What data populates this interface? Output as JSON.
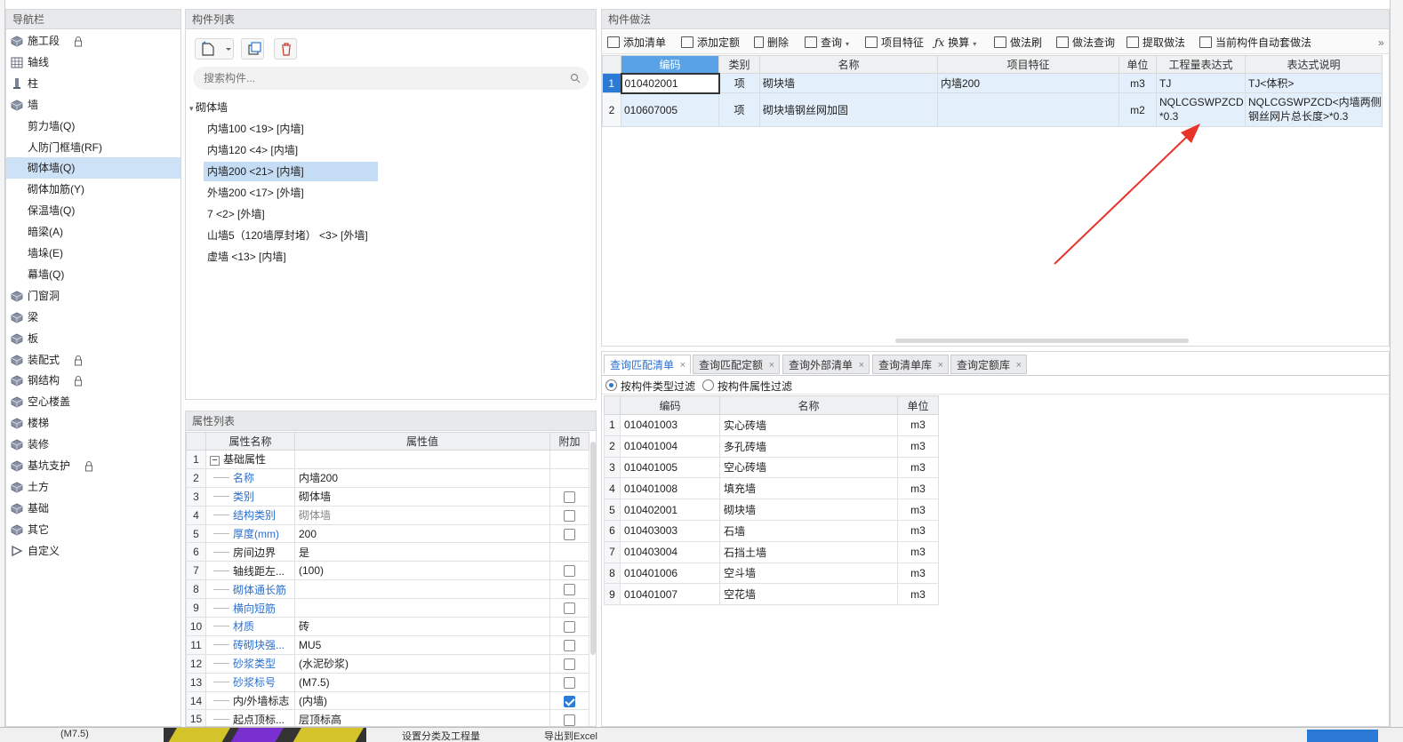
{
  "nav": {
    "title": "导航栏",
    "items": [
      {
        "label": "施工段",
        "icon": "stage-icon",
        "locked": true
      },
      {
        "label": "轴线",
        "icon": "grid-icon"
      },
      {
        "label": "柱",
        "icon": "column-icon"
      },
      {
        "label": "墙",
        "icon": "wall-icon"
      },
      {
        "label": "剪力墙(Q)",
        "sub": true
      },
      {
        "label": "人防门框墙(RF)",
        "sub": true
      },
      {
        "label": "砌体墙(Q)",
        "sub": true,
        "selected": true
      },
      {
        "label": "砌体加筋(Y)",
        "sub": true
      },
      {
        "label": "保温墙(Q)",
        "sub": true
      },
      {
        "label": "暗梁(A)",
        "sub": true
      },
      {
        "label": "墙垛(E)",
        "sub": true
      },
      {
        "label": "幕墙(Q)",
        "sub": true
      },
      {
        "label": "门窗洞",
        "icon": "door-window-icon"
      },
      {
        "label": "梁",
        "icon": "beam-icon"
      },
      {
        "label": "板",
        "icon": "slab-icon"
      },
      {
        "label": "装配式",
        "icon": "prefab-icon",
        "locked": true
      },
      {
        "label": "钢结构",
        "icon": "steel-icon",
        "locked": true
      },
      {
        "label": "空心楼盖",
        "icon": "hollow-floor-icon"
      },
      {
        "label": "楼梯",
        "icon": "stair-icon"
      },
      {
        "label": "装修",
        "icon": "decoration-icon"
      },
      {
        "label": "基坑支护",
        "icon": "pit-support-icon",
        "locked": true
      },
      {
        "label": "土方",
        "icon": "earthwork-icon"
      },
      {
        "label": "基础",
        "icon": "foundation-icon"
      },
      {
        "label": "其它",
        "icon": "other-icon"
      },
      {
        "label": "自定义",
        "icon": "custom-icon"
      }
    ]
  },
  "components": {
    "title": "构件列表",
    "search_placeholder": "搜索构件...",
    "group": "砌体墙",
    "items": [
      {
        "label": "内墙100 <19> [内墙]"
      },
      {
        "label": "内墙120 <4> [内墙]"
      },
      {
        "label": "内墙200 <21> [内墙]",
        "selected": true
      },
      {
        "label": "外墙200 <17> [外墙]"
      },
      {
        "label": "7 <2> [外墙]"
      },
      {
        "label": "山墙5（120墙厚封堵） <3> [外墙]"
      },
      {
        "label": "虚墙 <13> [内墙]"
      }
    ]
  },
  "props": {
    "title": "属性列表",
    "headers": [
      "属性名称",
      "属性值",
      "附加"
    ],
    "rows": [
      {
        "n": "1",
        "name": "基础属性",
        "value": "",
        "check": null,
        "group": true
      },
      {
        "n": "2",
        "name": "名称",
        "value": "内墙200",
        "check": null,
        "blue": true
      },
      {
        "n": "3",
        "name": "类别",
        "value": "砌体墙",
        "check": false,
        "blue": true
      },
      {
        "n": "4",
        "name": "结构类别",
        "value": "砌体墙",
        "check": false,
        "blue": true,
        "grey": true
      },
      {
        "n": "5",
        "name": "厚度(mm)",
        "value": "200",
        "check": false,
        "blue": true
      },
      {
        "n": "6",
        "name": "房间边界",
        "value": "是",
        "check": null
      },
      {
        "n": "7",
        "name": "轴线距左...",
        "value": "(100)",
        "check": false
      },
      {
        "n": "8",
        "name": "砌体通长筋",
        "value": "",
        "check": false,
        "blue": true
      },
      {
        "n": "9",
        "name": "横向短筋",
        "value": "",
        "check": false,
        "blue": true
      },
      {
        "n": "10",
        "name": "材质",
        "value": "砖",
        "check": false,
        "blue": true
      },
      {
        "n": "11",
        "name": "砖砌块强...",
        "value": "MU5",
        "check": false,
        "blue": true
      },
      {
        "n": "12",
        "name": "砂浆类型",
        "value": "(水泥砂浆)",
        "check": false,
        "blue": true
      },
      {
        "n": "13",
        "name": "砂浆标号",
        "value": "(M7.5)",
        "check": false,
        "blue": true
      },
      {
        "n": "14",
        "name": "内/外墙标志",
        "value": "(内墙)",
        "check": true
      },
      {
        "n": "15",
        "name": "起点顶标...",
        "value": "层顶标高",
        "check": false
      }
    ]
  },
  "method": {
    "title": "构件做法",
    "toolbar": [
      {
        "label": "添加清单"
      },
      {
        "label": "添加定额"
      },
      {
        "label": "删除"
      },
      {
        "label": "查询",
        "dropdown": true
      },
      {
        "label": "项目特征"
      },
      {
        "label": "换算",
        "dropdown": true
      },
      {
        "label": "做法刷"
      },
      {
        "label": "做法查询"
      },
      {
        "label": "提取做法"
      },
      {
        "label": "当前构件自动套做法"
      }
    ],
    "headers": [
      "编码",
      "类别",
      "名称",
      "项目特征",
      "单位",
      "工程量表达式",
      "表达式说明"
    ],
    "rows": [
      {
        "n": "1",
        "code": "010402001",
        "cat": "项",
        "name": "砌块墙",
        "feature": "内墙200",
        "unit": "m3",
        "expr": "TJ",
        "desc": "TJ<体积>"
      },
      {
        "n": "2",
        "code": "010607005",
        "cat": "项",
        "name": "砌块墙钢丝网加固",
        "feature": "",
        "unit": "m2",
        "expr": "NQLCGSWPZCD*0.3",
        "desc": "NQLCGSWPZCD<内墙两侧钢丝网片总长度>*0.3"
      }
    ]
  },
  "query": {
    "tabs": [
      "查询匹配清单",
      "查询匹配定额",
      "查询外部清单",
      "查询清单库",
      "查询定额库"
    ],
    "filter1": "按构件类型过滤",
    "filter2": "按构件属性过滤",
    "headers": [
      "编码",
      "名称",
      "单位"
    ],
    "rows": [
      {
        "n": "1",
        "code": "010401003",
        "name": "实心砖墙",
        "unit": "m3"
      },
      {
        "n": "2",
        "code": "010401004",
        "name": "多孔砖墙",
        "unit": "m3"
      },
      {
        "n": "3",
        "code": "010401005",
        "name": "空心砖墙",
        "unit": "m3"
      },
      {
        "n": "4",
        "code": "010401008",
        "name": "填充墙",
        "unit": "m3"
      },
      {
        "n": "5",
        "code": "010402001",
        "name": "砌块墙",
        "unit": "m3"
      },
      {
        "n": "6",
        "code": "010403003",
        "name": "石墙",
        "unit": "m3"
      },
      {
        "n": "7",
        "code": "010403004",
        "name": "石挡土墙",
        "unit": "m3"
      },
      {
        "n": "8",
        "code": "010401006",
        "name": "空斗墙",
        "unit": "m3"
      },
      {
        "n": "9",
        "code": "010401007",
        "name": "空花墙",
        "unit": "m3"
      }
    ]
  },
  "background": {
    "frag1": "(M7.5)",
    "frag2": "设置分类及工程量",
    "frag3": "导出到Excel"
  },
  "colors": {
    "accent": "#2a7ad6",
    "selection": "#cde1f7",
    "arrow": "#e8332b"
  }
}
